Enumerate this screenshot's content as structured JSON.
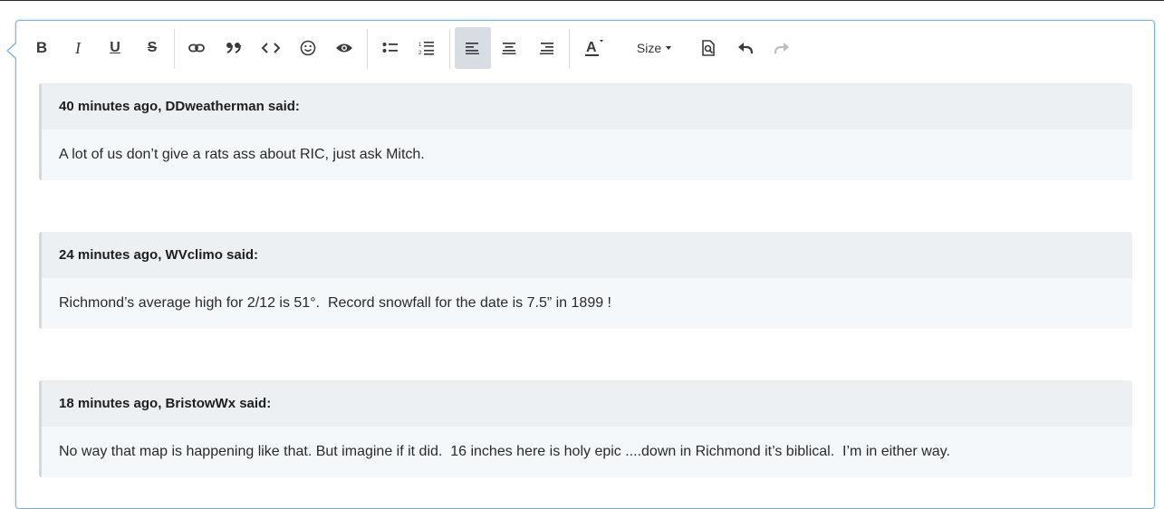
{
  "toolbar": {
    "bold": "B",
    "italic": "I",
    "underline": "U",
    "strike": "S",
    "size_label": "Size"
  },
  "quotes": [
    {
      "attribution": "40 minutes ago, DDweatherman said:",
      "text": "A lot of us don’t give a rats ass about RIC, just ask Mitch."
    },
    {
      "attribution": "24 minutes ago, WVclimo said:",
      "text": "Richmond’s average high for 2/12 is 51°.  Record snowfall for the date is 7.5” in 1899 !"
    },
    {
      "attribution": "18 minutes ago, BristowWx said:",
      "text": "No way that map is happening like that. But imagine if it did.  16 inches here is holy epic ....down in Richmond it’s biblical.  I’m in either way."
    }
  ]
}
